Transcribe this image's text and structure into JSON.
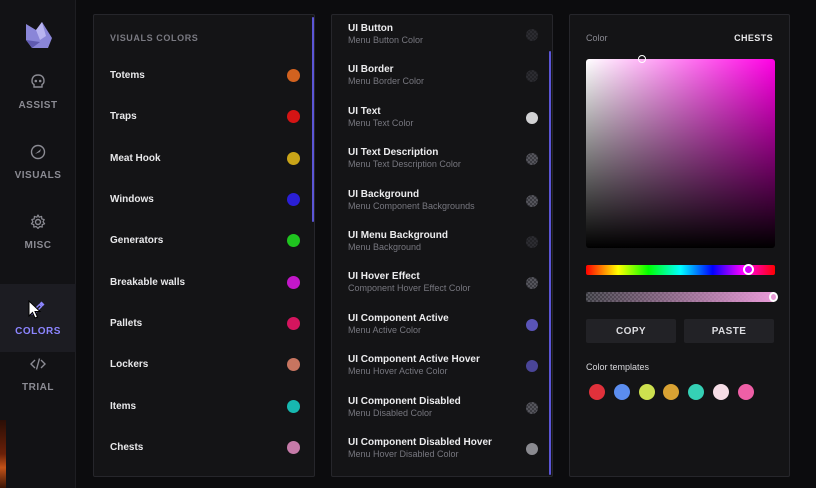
{
  "sidebar": {
    "items": [
      {
        "label": "ASSIST",
        "icon": "skull-icon"
      },
      {
        "label": "VISUALS",
        "icon": "eye-icon"
      },
      {
        "label": "MISC",
        "icon": "gear-icon"
      },
      {
        "label": "COLORS",
        "icon": "eyedropper-icon",
        "active": true
      },
      {
        "label": "TRIAL",
        "icon": "code-icon"
      }
    ]
  },
  "visuals": {
    "title": "VISUALS COLORS",
    "items": [
      {
        "label": "Totems",
        "color": "#d2621f"
      },
      {
        "label": "Traps",
        "color": "#d41414"
      },
      {
        "label": "Meat Hook",
        "color": "#c9a418"
      },
      {
        "label": "Windows",
        "color": "#2a1fd6"
      },
      {
        "label": "Generators",
        "color": "#1fc41f"
      },
      {
        "label": "Breakable walls",
        "color": "#c217c9"
      },
      {
        "label": "Pallets",
        "color": "#d4155e"
      },
      {
        "label": "Lockers",
        "color": "#c77560"
      },
      {
        "label": "Items",
        "color": "#17b8b0"
      },
      {
        "label": "Chests",
        "color": "#c57aa8"
      }
    ]
  },
  "ui_colors": {
    "items": [
      {
        "title": "UI Button",
        "sub": "Menu Button Color",
        "swatch": "checker-dark"
      },
      {
        "title": "UI Border",
        "sub": "Menu Border Color",
        "swatch": "checker-dark"
      },
      {
        "title": "UI Text",
        "sub": "Menu Text Color",
        "swatch": "#d2d2d4"
      },
      {
        "title": "UI Text Description",
        "sub": "Menu Text Description Color",
        "swatch": "checker"
      },
      {
        "title": "UI Background",
        "sub": "Menu Component Backgrounds",
        "swatch": "checker"
      },
      {
        "title": "UI Menu Background",
        "sub": "Menu Background",
        "swatch": "checker-dark"
      },
      {
        "title": "UI Hover Effect",
        "sub": "Component Hover Effect Color",
        "swatch": "checker"
      },
      {
        "title": "UI Component Active",
        "sub": "Menu Active Color",
        "swatch": "#5a54b8"
      },
      {
        "title": "UI Component Active Hover",
        "sub": "Menu Hover Active Color",
        "swatch": "#4a4598"
      },
      {
        "title": "UI Component Disabled",
        "sub": "Menu Disabled Color",
        "swatch": "checker"
      },
      {
        "title": "UI Component Disabled Hover",
        "sub": "Menu Hover Disabled Color",
        "swatch": "#8a8a90"
      }
    ]
  },
  "picker": {
    "label": "Color",
    "target": "CHESTS",
    "hue_color": "#ff00e4",
    "copy_label": "COPY",
    "paste_label": "PASTE",
    "templates_label": "Color templates",
    "templates": [
      "#e0313b",
      "#5b8def",
      "#cde04f",
      "#d9a233",
      "#35d0b5",
      "#f6dde6",
      "#ee5fa6"
    ]
  }
}
